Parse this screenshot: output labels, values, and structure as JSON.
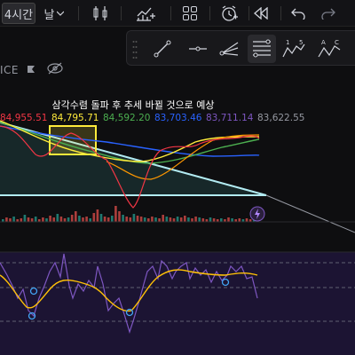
{
  "toolbar": {
    "timeframe": "4시간",
    "timeframe_day": "날",
    "icons": [
      "candles-icon",
      "indicators-icon",
      "layout-grid-icon",
      "alert-clock-icon",
      "replay-icon",
      "undo-icon",
      "redo-icon"
    ]
  },
  "subbar": {
    "ticker_fragment": "ICE",
    "draw_tools": [
      "trendline-icon",
      "horizontal-line-icon",
      "pitchfork-icon",
      "fib-retracement-icon",
      "elliott-wave-icon",
      "pattern-icon"
    ],
    "wave_labels": [
      "1",
      "5"
    ],
    "pattern_labels": [
      "A",
      "C"
    ]
  },
  "chart": {
    "annotation": "삼각수렴 돌파 후 추세 바뀔 것으로 예상",
    "price_labels": [
      "84,955.51",
      "84,795.71",
      "84,592.20",
      "83,703.46",
      "83,711.14",
      "83,622.55"
    ],
    "price_label_colors": [
      "#f23645",
      "#ffeb3b",
      "#4caf50",
      "#2962ff",
      "#7e57c2",
      "#9598a1"
    ],
    "colors": {
      "triangle_line": "#b2ebf2",
      "triangle_fill": "#1e3a3a",
      "ma_yellow": "#ffeb3b",
      "ma_red": "#f23645",
      "ma_green": "#4caf50",
      "ma_blue": "#2962ff",
      "ma_orange": "#ff9800",
      "rsi_line": "#7e57c2",
      "rsi_signal": "#ffc107",
      "rsi_bg": "#1c1433",
      "volume_up": "#26a69a",
      "volume_down": "#ef5350"
    }
  }
}
